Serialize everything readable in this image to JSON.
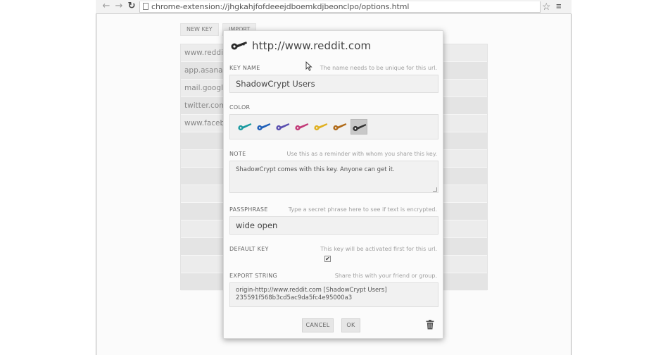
{
  "browser": {
    "url": "chrome-extension://jhgkahjfofdeeejdboemkdjbeonclpo/options.html",
    "back_icon": "back-arrow-icon",
    "forward_icon": "forward-arrow-icon",
    "reload_icon": "reload-icon",
    "star_icon": "star-icon",
    "menu_icon": "menu-icon"
  },
  "page": {
    "new_key_label": "NEW KEY",
    "import_label": "IMPORT",
    "origins": [
      "www.reddit.",
      "app.asana.c",
      "mail.google.",
      "twitter.com",
      "www.facebo"
    ]
  },
  "dialog": {
    "title": "http://www.reddit.com",
    "key_name": {
      "label": "KEY NAME",
      "hint": "The name needs to be unique for this url.",
      "value": "ShadowCrypt Users"
    },
    "color": {
      "label": "COLOR",
      "swatches": [
        "#1a9aa0",
        "#1f5fb8",
        "#5a4fb0",
        "#c23a78",
        "#e0b020",
        "#b06a18",
        "#333333"
      ],
      "selected_index": 6
    },
    "note": {
      "label": "NOTE",
      "hint": "Use this as a reminder with whom you share this key.",
      "value": "ShadowCrypt comes with this key. Anyone can get it."
    },
    "passphrase": {
      "label": "PASSPHRASE",
      "hint": "Type a secret phrase here to see if text is encrypted.",
      "value": "wide open"
    },
    "default_key": {
      "label": "DEFAULT KEY",
      "hint": "This key will be activated first for this url.",
      "checked": true,
      "check_glyph": "✔"
    },
    "export_string": {
      "label": "EXPORT STRING",
      "hint": "Share this with your friend or group.",
      "line1": "origin-http://www.reddit.com [ShadowCrypt Users]",
      "line2": "235591f568b3cd5ac9da5fc4e95000a3"
    },
    "cancel_label": "CANCEL",
    "ok_label": "OK",
    "trash_icon": "trash-icon"
  }
}
